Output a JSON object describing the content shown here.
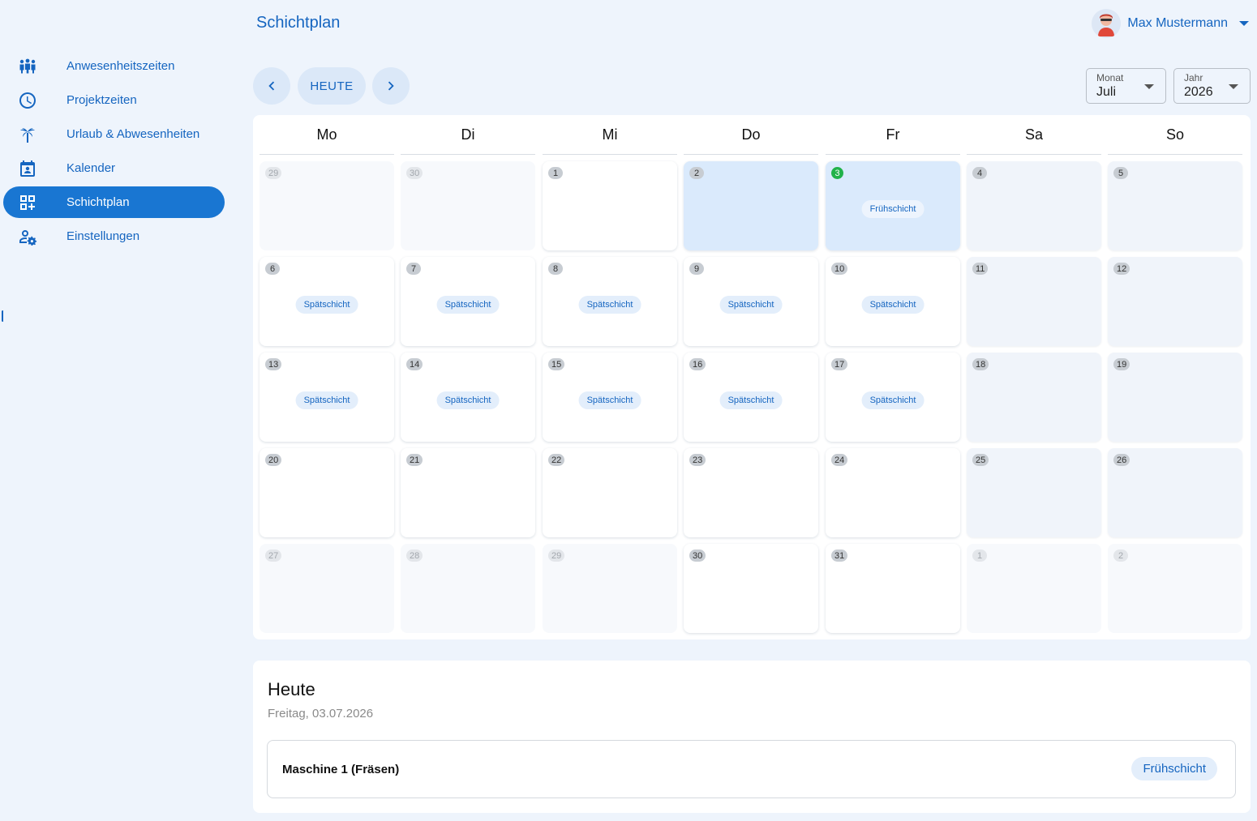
{
  "header": {
    "title": "Schichtplan",
    "user_name": "Max Mustermann"
  },
  "sidebar": {
    "items": [
      {
        "label": "Anwesenheitszeiten",
        "icon": "people-group-icon",
        "active": false
      },
      {
        "label": "Projektzeiten",
        "icon": "clock-icon",
        "active": false
      },
      {
        "label": "Urlaub & Abwesenheiten",
        "icon": "palm-tree-icon",
        "active": false
      },
      {
        "label": "Kalender",
        "icon": "calendar-person-icon",
        "active": false
      },
      {
        "label": "Schichtplan",
        "icon": "grid-add-icon",
        "active": true
      },
      {
        "label": "Einstellungen",
        "icon": "user-settings-icon",
        "active": false
      }
    ]
  },
  "toolbar": {
    "prev_icon": "chevron-left-icon",
    "today_label": "HEUTE",
    "next_icon": "chevron-right-icon",
    "month": {
      "label": "Monat",
      "value": "Juli"
    },
    "year": {
      "label": "Jahr",
      "value": "2026"
    }
  },
  "calendar": {
    "weekdays": [
      "Mo",
      "Di",
      "Mi",
      "Do",
      "Fr",
      "Sa",
      "So"
    ],
    "weeks": [
      [
        {
          "day": "29",
          "type": "out"
        },
        {
          "day": "30",
          "type": "out"
        },
        {
          "day": "1",
          "type": "in"
        },
        {
          "day": "2",
          "type": "hl"
        },
        {
          "day": "3",
          "type": "hl",
          "today": true,
          "shift": "Frühschicht"
        },
        {
          "day": "4",
          "type": "wk"
        },
        {
          "day": "5",
          "type": "wk"
        }
      ],
      [
        {
          "day": "6",
          "type": "in",
          "shift": "Spätschicht"
        },
        {
          "day": "7",
          "type": "in",
          "shift": "Spätschicht"
        },
        {
          "day": "8",
          "type": "in",
          "shift": "Spätschicht"
        },
        {
          "day": "9",
          "type": "in",
          "shift": "Spätschicht"
        },
        {
          "day": "10",
          "type": "in",
          "shift": "Spätschicht"
        },
        {
          "day": "11",
          "type": "wk"
        },
        {
          "day": "12",
          "type": "wk"
        }
      ],
      [
        {
          "day": "13",
          "type": "in",
          "shift": "Spätschicht"
        },
        {
          "day": "14",
          "type": "in",
          "shift": "Spätschicht"
        },
        {
          "day": "15",
          "type": "in",
          "shift": "Spätschicht"
        },
        {
          "day": "16",
          "type": "in",
          "shift": "Spätschicht"
        },
        {
          "day": "17",
          "type": "in",
          "shift": "Spätschicht"
        },
        {
          "day": "18",
          "type": "wk"
        },
        {
          "day": "19",
          "type": "wk"
        }
      ],
      [
        {
          "day": "20",
          "type": "in"
        },
        {
          "day": "21",
          "type": "in"
        },
        {
          "day": "22",
          "type": "in"
        },
        {
          "day": "23",
          "type": "in"
        },
        {
          "day": "24",
          "type": "in"
        },
        {
          "day": "25",
          "type": "wk"
        },
        {
          "day": "26",
          "type": "wk"
        }
      ],
      [
        {
          "day": "27",
          "type": "out"
        },
        {
          "day": "28",
          "type": "out"
        },
        {
          "day": "29",
          "type": "out"
        },
        {
          "day": "30",
          "type": "in"
        },
        {
          "day": "31",
          "type": "in"
        },
        {
          "day": "1",
          "type": "out"
        },
        {
          "day": "2",
          "type": "out"
        }
      ]
    ]
  },
  "today_panel": {
    "title": "Heute",
    "date": "Freitag, 03.07.2026",
    "entries": [
      {
        "machine": "Maschine 1 (Fräsen)",
        "shift": "Frühschicht"
      }
    ]
  },
  "colors": {
    "primary": "#1976d2",
    "text_primary": "#1565c0",
    "today_badge": "#21b24a",
    "background": "#eef4fc"
  }
}
